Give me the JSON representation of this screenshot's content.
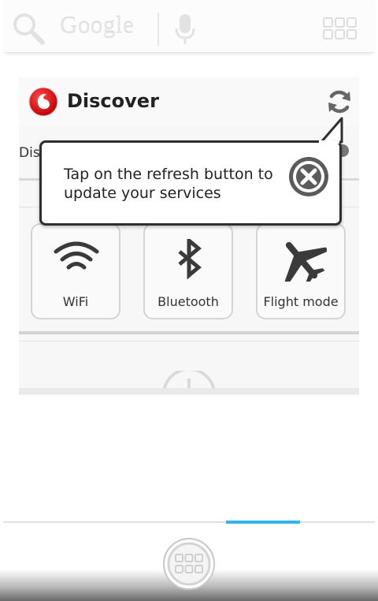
{
  "search_bar": {
    "logo_text": "Google"
  },
  "widget": {
    "title": "Discover",
    "partial_label": "Dis",
    "tiles": [
      {
        "label": "WiFi",
        "icon": "wifi-icon"
      },
      {
        "label": "Bluetooth",
        "icon": "bluetooth-icon"
      },
      {
        "label": "Flight mode",
        "icon": "airplane-icon"
      }
    ]
  },
  "tooltip": {
    "text": "Tap on the refresh button to update your services"
  },
  "colors": {
    "accent": "#33b5e5",
    "vodafone_red": "#e60000",
    "tooltip_border": "#2f2f2f"
  },
  "icons": {
    "search": "search-icon",
    "mic": "microphone-icon",
    "apps": "apps-grid-icon",
    "refresh": "refresh-icon",
    "close": "close-icon",
    "logo": "vodafone-logo"
  },
  "pager": {
    "active_page": 4,
    "page_count": 5
  }
}
